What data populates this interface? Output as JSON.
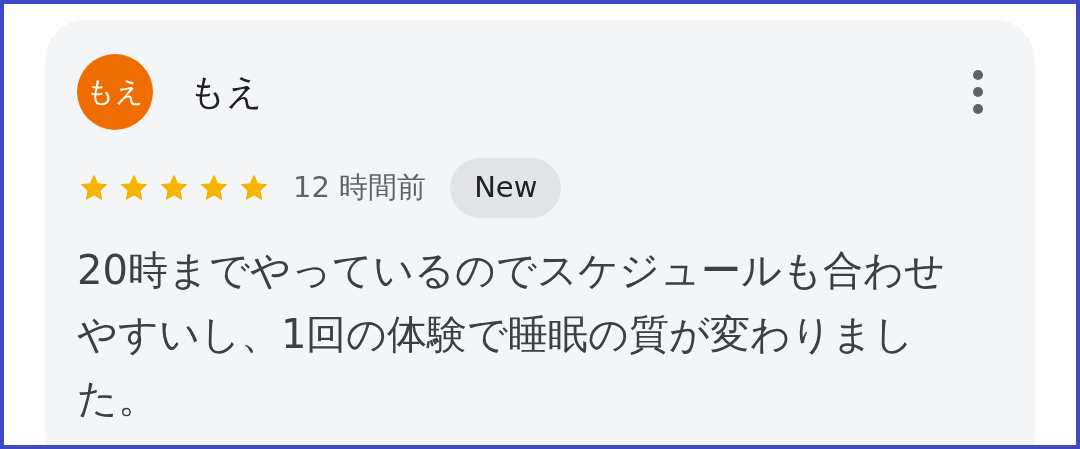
{
  "review": {
    "avatar": {
      "text": "もえ",
      "color": "#ef6c00"
    },
    "name": "もえ",
    "stars": 5,
    "time": "12 時間前",
    "badge": "New",
    "text": "20時までやっているのでスケジュールも合わせやすいし、1回の体験で睡眠の質が変わりました。"
  }
}
